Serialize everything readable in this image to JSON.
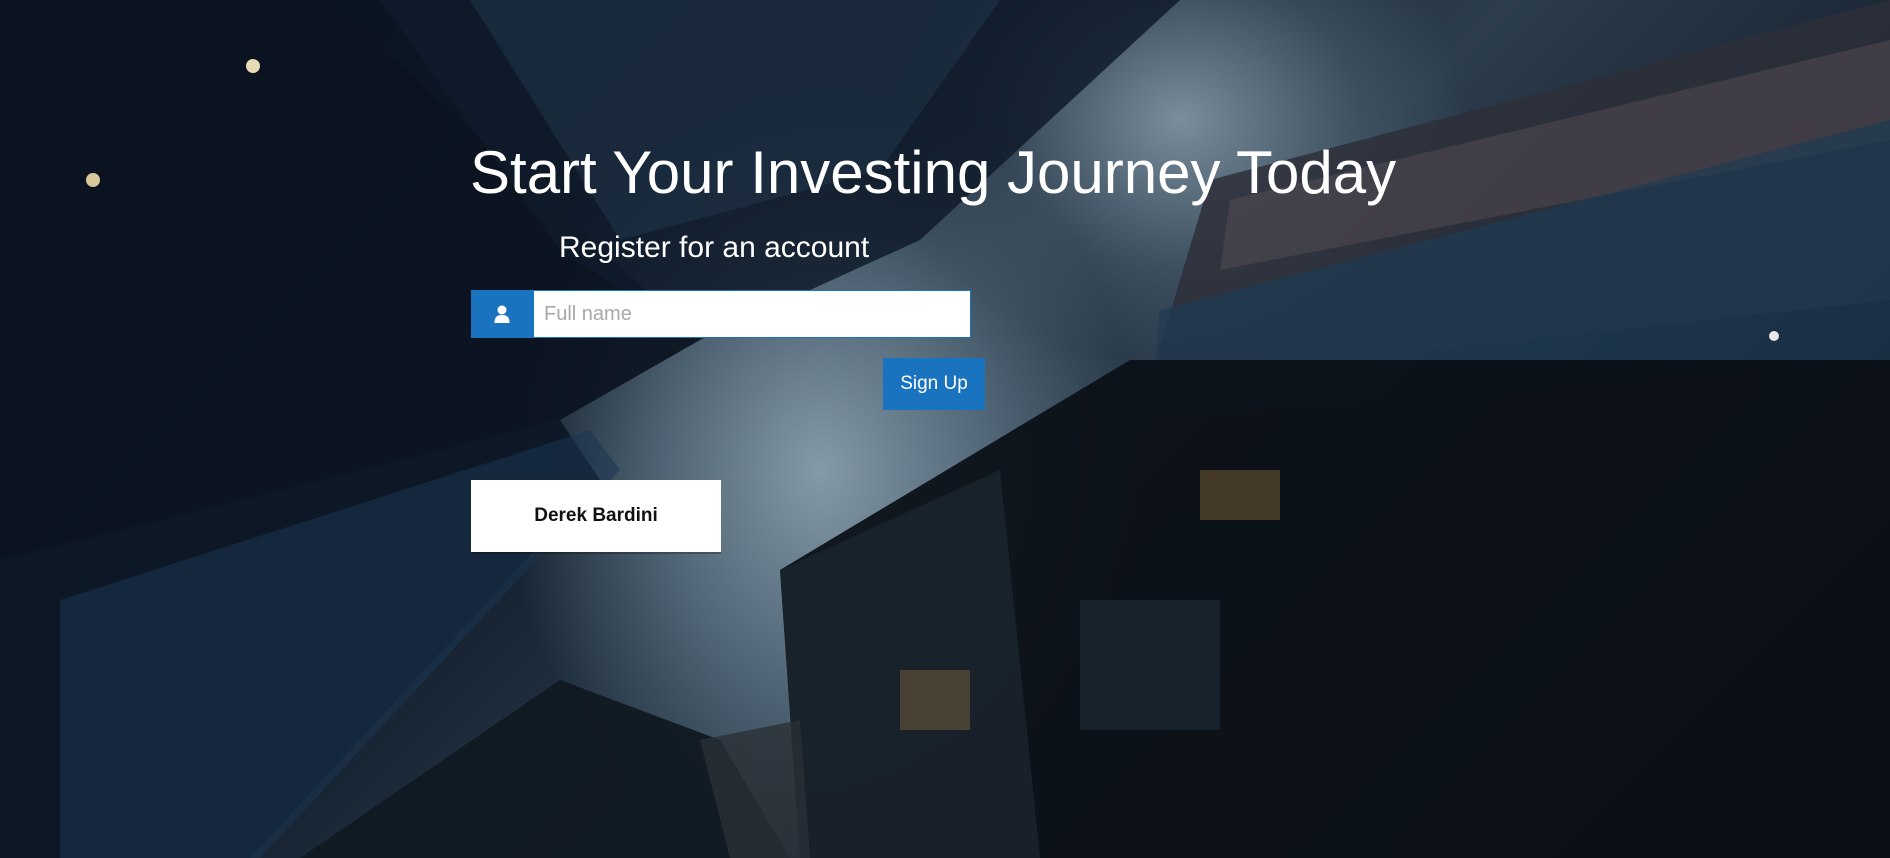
{
  "hero": {
    "title": "Start Your Investing Journey Today",
    "subtitle": "Register for an account"
  },
  "form": {
    "full_name_placeholder": "Full name",
    "full_name_value": "",
    "user_icon": "user-icon",
    "signup_label": "Sign Up"
  },
  "card": {
    "name": "Derek Bardini"
  },
  "colors": {
    "accent": "#1a73bf",
    "text_light": "#ffffff",
    "card_bg": "#ffffff"
  }
}
